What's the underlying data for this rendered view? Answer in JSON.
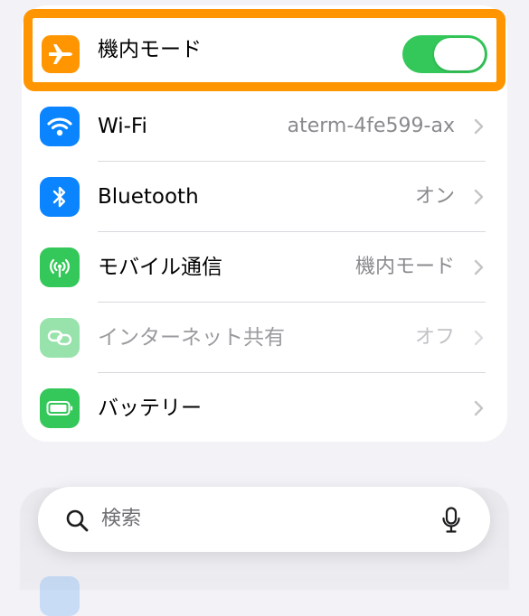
{
  "settings": {
    "airplane_mode": {
      "label": "機内モード",
      "icon": "airplane-icon",
      "icon_color": "#ff9500",
      "toggle_on": true
    },
    "items": [
      {
        "label": "Wi-Fi",
        "value": "aterm-4fe599-ax",
        "icon": "wifi-icon",
        "icon_color": "#0a84ff"
      },
      {
        "label": "Bluetooth",
        "value": "オン",
        "icon": "bluetooth-icon",
        "icon_color": "#0a84ff"
      },
      {
        "label": "モバイル通信",
        "value": "機内モード",
        "icon": "antenna-icon",
        "icon_color": "#34c759"
      },
      {
        "label": "インターネット共有",
        "value": "オフ",
        "icon": "hotspot-link-icon",
        "icon_color": "#34c759",
        "disabled": true
      },
      {
        "label": "バッテリー",
        "value": "",
        "icon": "battery-icon",
        "icon_color": "#34c759"
      }
    ]
  },
  "search": {
    "placeholder": "検索"
  },
  "colors": {
    "highlight": "#ff9500",
    "toggle_on": "#34c759",
    "background": "#f2f2f7"
  }
}
